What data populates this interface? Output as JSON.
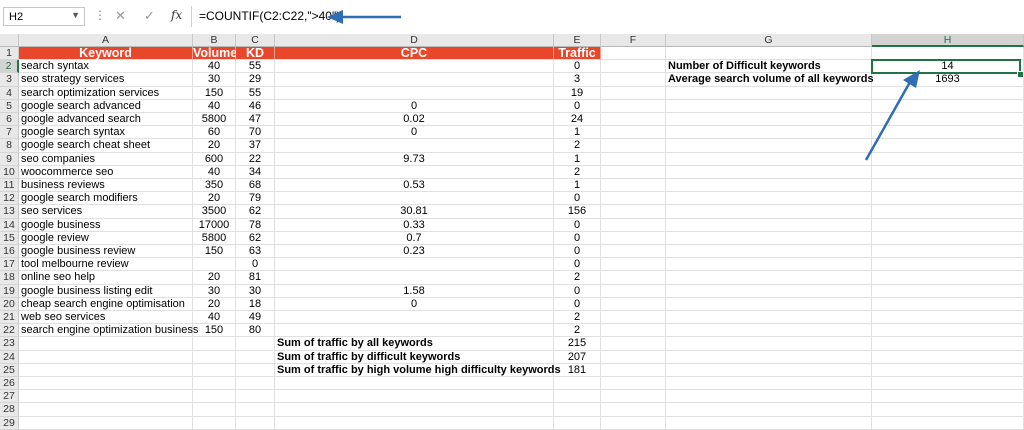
{
  "formula_bar": {
    "name_box": "H2",
    "formula": "=COUNTIF(C2:C22,\">40\")"
  },
  "columns": [
    "A",
    "B",
    "C",
    "D",
    "E",
    "F",
    "G",
    "H"
  ],
  "row_numbers": [
    "1",
    "2",
    "3",
    "4",
    "5",
    "6",
    "7",
    "8",
    "9",
    "10",
    "11",
    "12",
    "13",
    "14",
    "15",
    "16",
    "17",
    "18",
    "19",
    "20",
    "21",
    "22",
    "23",
    "24",
    "25",
    "26",
    "27",
    "28",
    "29"
  ],
  "table_headers": {
    "keyword": "Keyword",
    "volume": "Volume",
    "kd": "KD",
    "cpc": "CPC",
    "traffic": "Traffic"
  },
  "rows": [
    {
      "keyword": "search syntax",
      "volume": "40",
      "kd": "55",
      "cpc": "",
      "traffic": "0"
    },
    {
      "keyword": "seo strategy services",
      "volume": "30",
      "kd": "29",
      "cpc": "",
      "traffic": "3"
    },
    {
      "keyword": "search optimization services",
      "volume": "150",
      "kd": "55",
      "cpc": "",
      "traffic": "19"
    },
    {
      "keyword": "google search advanced",
      "volume": "40",
      "kd": "46",
      "cpc": "0",
      "traffic": "0"
    },
    {
      "keyword": "google advanced search",
      "volume": "5800",
      "kd": "47",
      "cpc": "0.02",
      "traffic": "24"
    },
    {
      "keyword": "google search syntax",
      "volume": "60",
      "kd": "70",
      "cpc": "0",
      "traffic": "1"
    },
    {
      "keyword": "google search cheat sheet",
      "volume": "20",
      "kd": "37",
      "cpc": "",
      "traffic": "2"
    },
    {
      "keyword": "seo companies",
      "volume": "600",
      "kd": "22",
      "cpc": "9.73",
      "traffic": "1"
    },
    {
      "keyword": "woocommerce seo",
      "volume": "40",
      "kd": "34",
      "cpc": "",
      "traffic": "2"
    },
    {
      "keyword": "business reviews",
      "volume": "350",
      "kd": "68",
      "cpc": "0.53",
      "traffic": "1"
    },
    {
      "keyword": "google search modifiers",
      "volume": "20",
      "kd": "79",
      "cpc": "",
      "traffic": "0"
    },
    {
      "keyword": "seo services",
      "volume": "3500",
      "kd": "62",
      "cpc": "30.81",
      "traffic": "156"
    },
    {
      "keyword": "google business",
      "volume": "17000",
      "kd": "78",
      "cpc": "0.33",
      "traffic": "0"
    },
    {
      "keyword": "google review",
      "volume": "5800",
      "kd": "62",
      "cpc": "0.7",
      "traffic": "0"
    },
    {
      "keyword": "google business review",
      "volume": "150",
      "kd": "63",
      "cpc": "0.23",
      "traffic": "0"
    },
    {
      "keyword": "tool melbourne review",
      "volume": "",
      "kd": "0",
      "cpc": "",
      "traffic": "0"
    },
    {
      "keyword": "online seo help",
      "volume": "20",
      "kd": "81",
      "cpc": "",
      "traffic": "2"
    },
    {
      "keyword": "google business listing edit",
      "volume": "30",
      "kd": "30",
      "cpc": "1.58",
      "traffic": "0"
    },
    {
      "keyword": "cheap search engine optimisation",
      "volume": "20",
      "kd": "18",
      "cpc": "0",
      "traffic": "0"
    },
    {
      "keyword": "web seo services",
      "volume": "40",
      "kd": "49",
      "cpc": "",
      "traffic": "2"
    },
    {
      "keyword": "search engine optimization business",
      "volume": "150",
      "kd": "80",
      "cpc": "",
      "traffic": "2"
    }
  ],
  "summary": [
    {
      "label": "Sum of traffic by all keywords",
      "value": "215"
    },
    {
      "label": "Sum of traffic by difficult keywords",
      "value": "207"
    },
    {
      "label": "Sum of traffic by high volume high difficulty keywords",
      "value": "181"
    }
  ],
  "stats": [
    {
      "label": "Number of Difficult keywords",
      "value": "14"
    },
    {
      "label": "Average search volume of all keywords",
      "value": "1693"
    }
  ],
  "colors": {
    "header_fill": "#e8472b",
    "selection": "#217346",
    "annotation_arrow": "#2f6db5"
  }
}
